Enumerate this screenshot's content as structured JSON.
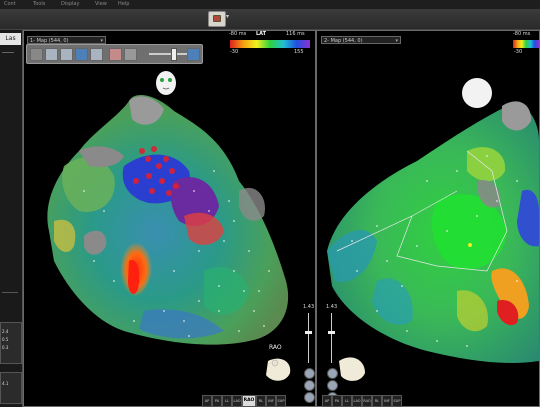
{
  "menu": {
    "items": [
      "Cont",
      "Tools",
      "Display",
      "View",
      "Help"
    ]
  },
  "left_panel": {
    "tab_label": "Las",
    "values": [
      "2.4",
      "0.5",
      "0.3",
      "4.1"
    ]
  },
  "viewports": {
    "left": {
      "map_select": "1- Map (544, 0)",
      "lat": {
        "title": "LAT",
        "min_ms": "-80 ms",
        "max_ms": "116 ms",
        "low": "-30",
        "high": "155"
      },
      "heart_orientation": "RAO",
      "view_buttons": [
        "AP",
        "PA",
        "LL",
        "LAO",
        "RAO",
        "RL",
        "INF",
        "SUP"
      ],
      "active_view": "RAO",
      "zoom_label": "1.43"
    },
    "right": {
      "map_select": "2- Map (544, 0)",
      "lat": {
        "min_ms": "-80 ms",
        "low": "-30"
      },
      "view_buttons": [
        "AP",
        "PA",
        "LL",
        "LAO",
        "RAO",
        "RL",
        "INF",
        "SUP"
      ],
      "zoom_label": "1.43"
    }
  },
  "colors": {
    "lat_gradient": [
      "#e02020",
      "#f2a010",
      "#f0f020",
      "#30d040",
      "#20c0d0",
      "#2050e0",
      "#9030d0"
    ]
  },
  "icons": [
    "camera-icon",
    "chevron-down-icon",
    "face-icon",
    "sphere-icon",
    "heart-orientation-icon",
    "zoom-in-icon",
    "zoom-out-icon"
  ]
}
